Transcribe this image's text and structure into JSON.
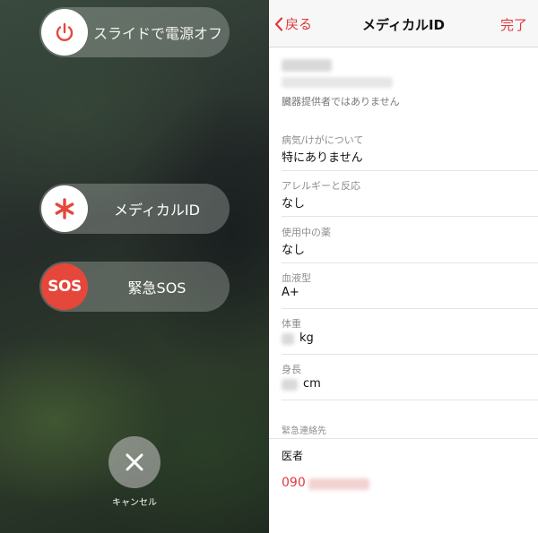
{
  "power_screen": {
    "slide_label": "スライドで電源オフ",
    "medical_label": "メディカルID",
    "sos_knob": "SOS",
    "sos_label": "緊急SOS",
    "cancel_label": "キャンセル"
  },
  "medical_id": {
    "back_label": "戻る",
    "title": "メディカルID",
    "done_label": "完了",
    "donor_status": "臓器提供者ではありません",
    "fields": [
      {
        "label": "病気/けがについて",
        "value": "特にありません"
      },
      {
        "label": "アレルギーと反応",
        "value": "なし"
      },
      {
        "label": "使用中の薬",
        "value": "なし"
      },
      {
        "label": "血液型",
        "value": "A+"
      },
      {
        "label": "体重",
        "value": "kg"
      },
      {
        "label": "身長",
        "value": "cm"
      }
    ],
    "emergency_section": "緊急連絡先",
    "contact_role": "医者",
    "contact_phone_prefix": "090"
  },
  "colors": {
    "accent_red": "#e0383c",
    "sos_red": "#e5473b"
  },
  "icons": {
    "power": "power-icon",
    "medical": "asterisk-icon",
    "cancel": "close-icon",
    "back": "chevron-left-icon"
  }
}
